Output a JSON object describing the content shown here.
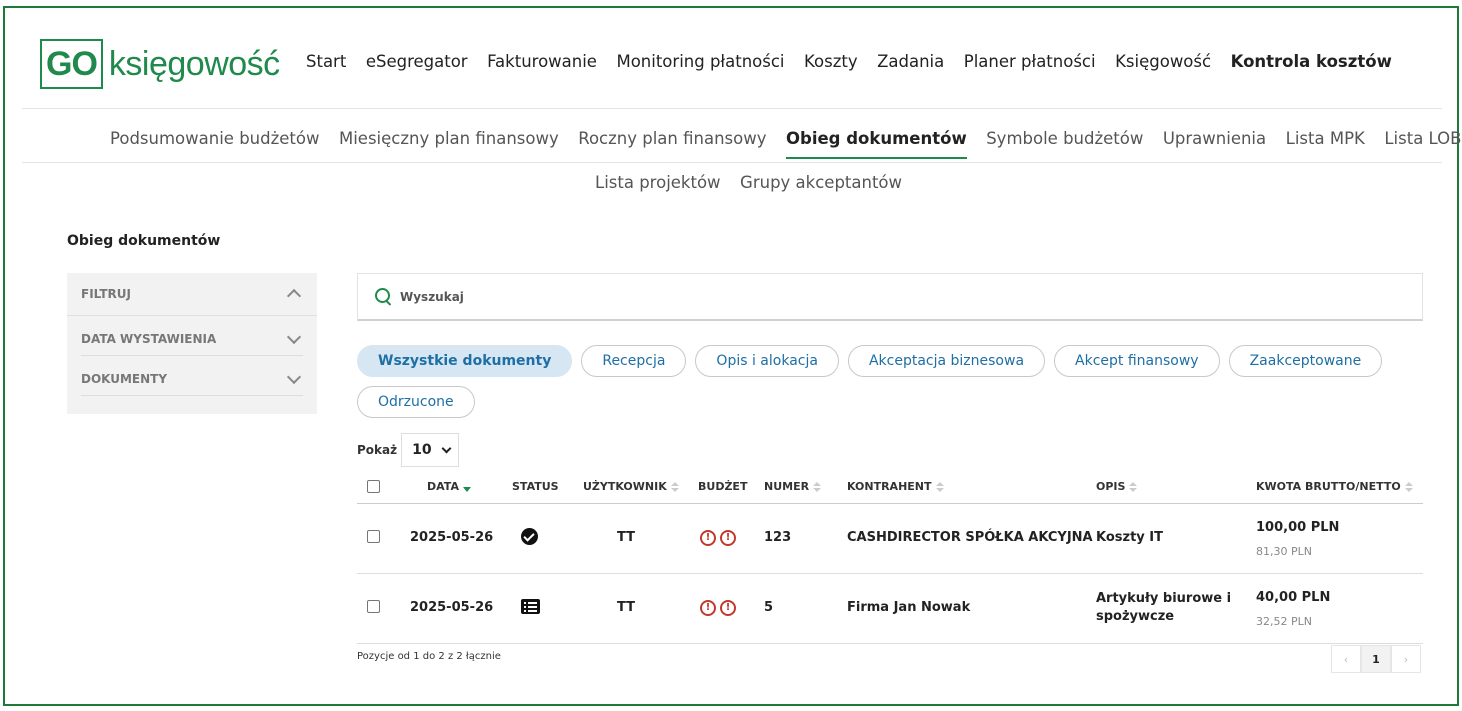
{
  "header": {
    "logo_go": "GO",
    "logo_text": "księgowość",
    "nav": [
      "Start",
      "eSegregator",
      "Fakturowanie",
      "Monitoring płatności",
      "Koszty",
      "Zadania",
      "Planer płatności",
      "Księgowość",
      "Kontrola kosztów"
    ],
    "active_nav": "Kontrola kosztów"
  },
  "subnav": {
    "items": [
      "Podsumowanie budżetów",
      "Miesięczny plan finansowy",
      "Roczny plan finansowy",
      "Obieg dokumentów",
      "Symbole budżetów",
      "Uprawnienia",
      "Lista MPK",
      "Lista LOB"
    ],
    "items2": [
      "Lista projektów",
      "Grupy akceptantów"
    ],
    "active": "Obieg dokumentów"
  },
  "page": {
    "title": "Obieg dokumentów"
  },
  "filters": {
    "head": "FILTRUJ",
    "rows": [
      "DATA WYSTAWIENIA",
      "DOKUMENTY"
    ]
  },
  "search": {
    "placeholder": "Wyszukaj"
  },
  "chips": [
    "Wszystkie dokumenty",
    "Recepcja",
    "Opis i alokacja",
    "Akceptacja biznesowa",
    "Akcept finansowy",
    "Zaakceptowane",
    "Odrzucone"
  ],
  "chips_active": "Wszystkie dokumenty",
  "page_length": {
    "label": "Pokaż",
    "value": "10"
  },
  "table": {
    "headers": {
      "data": "DATA",
      "status": "STATUS",
      "user": "UŻYTKOWNIK",
      "budget": "BUDŻET",
      "number": "NUMER",
      "contractor": "KONTRAHENT",
      "desc": "OPIS",
      "amount": "KWOTA BRUTTO/NETTO"
    },
    "rows": [
      {
        "date": "2025-05-26",
        "status_icon": "check-circle-icon",
        "user": "TT",
        "budget_icons": [
          "!",
          "!"
        ],
        "number": "123",
        "contractor": "CASHDIRECTOR SPÓŁKA AKCYJNA",
        "desc": "Koszty IT",
        "gross": "100,00 PLN",
        "net": "81,30 PLN"
      },
      {
        "date": "2025-05-26",
        "status_icon": "list-icon",
        "user": "TT",
        "budget_icons": [
          "!",
          "!"
        ],
        "number": "5",
        "contractor": "Firma Jan Nowak",
        "desc": "Artykuły biurowe i spożywcze",
        "gross": "40,00 PLN",
        "net": "32,52 PLN"
      }
    ]
  },
  "footer": {
    "info": "Pozycje od 1 do 2 z 2 łącznie",
    "current_page": "1",
    "prev": "‹",
    "next": "›"
  },
  "colors": {
    "brand": "#1f8a4c",
    "link": "#1d6fa5",
    "alert": "#c0392b"
  }
}
